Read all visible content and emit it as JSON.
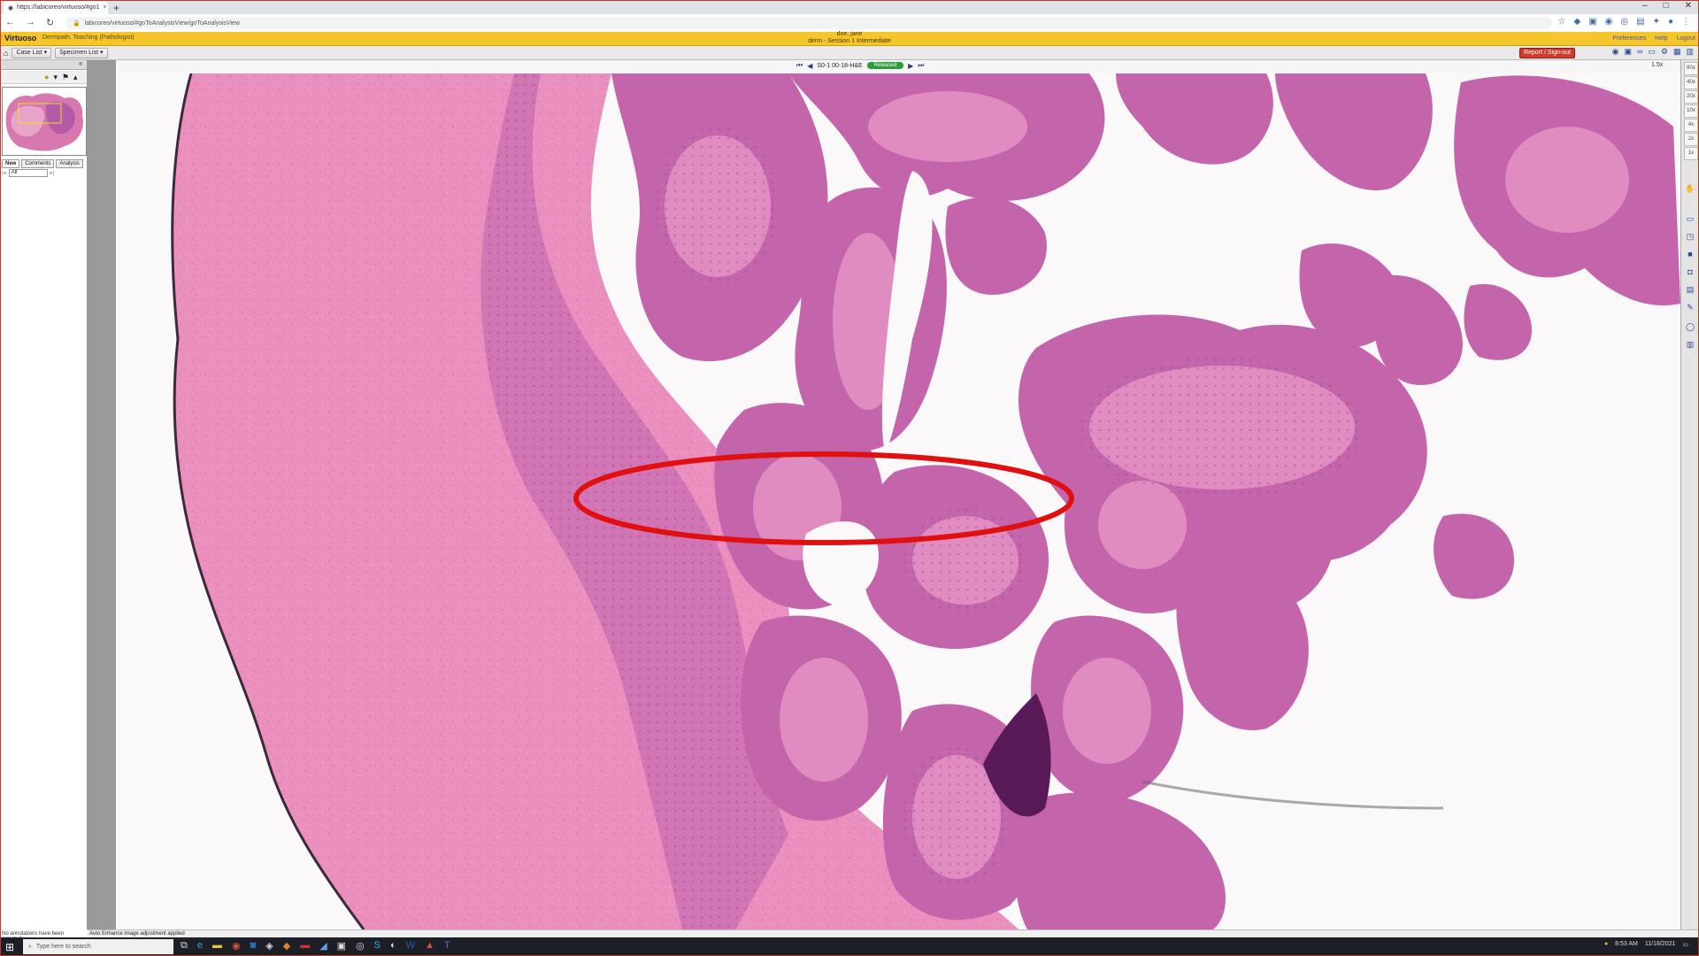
{
  "browser": {
    "tab_title": "https://labicoreo/virtuoso/#go1",
    "new_tab": "+",
    "url": "labicoreo/virtuoso/#goToAnalysisView/goToAnalysisView",
    "window_controls": [
      "–",
      "□",
      "✕"
    ]
  },
  "app": {
    "brand": "Virtuoso",
    "breadcrumb": "Dermpath, Teaching (Pathologist)",
    "user_name": "doe, jane",
    "session": "derm - Session 1 Intermediate",
    "header_links": [
      "Preferences",
      "Help",
      "Logout"
    ]
  },
  "toolbar": {
    "case_list": "Case List",
    "specimen_list": "Specimen List",
    "report_signout": "Report / Sign-out"
  },
  "slide": {
    "label": "S0-1 00-18-H&E",
    "status": "Released",
    "zoom_readout": "1.5x"
  },
  "zoom_levels": [
    "80x",
    "40x",
    "20x",
    "10x",
    "4x",
    "2x",
    "1x"
  ],
  "sidebar": {
    "tabs": [
      "New",
      "Comments",
      "Analysis"
    ],
    "filter_select": "All",
    "footer": "No annotations have been selected"
  },
  "statusbar": {
    "message": "Auto Enhance image adjustment applied"
  },
  "taskbar": {
    "search_placeholder": "Type here to search",
    "time": "8:53 AM",
    "date": "11/18/2021"
  },
  "colors": {
    "header_yellow": "#f4c62a",
    "tissue_pink": "#e07fb4",
    "tissue_purple": "#b45aa6",
    "annotation_red": "#e01010",
    "status_green": "#2c9c3a"
  }
}
